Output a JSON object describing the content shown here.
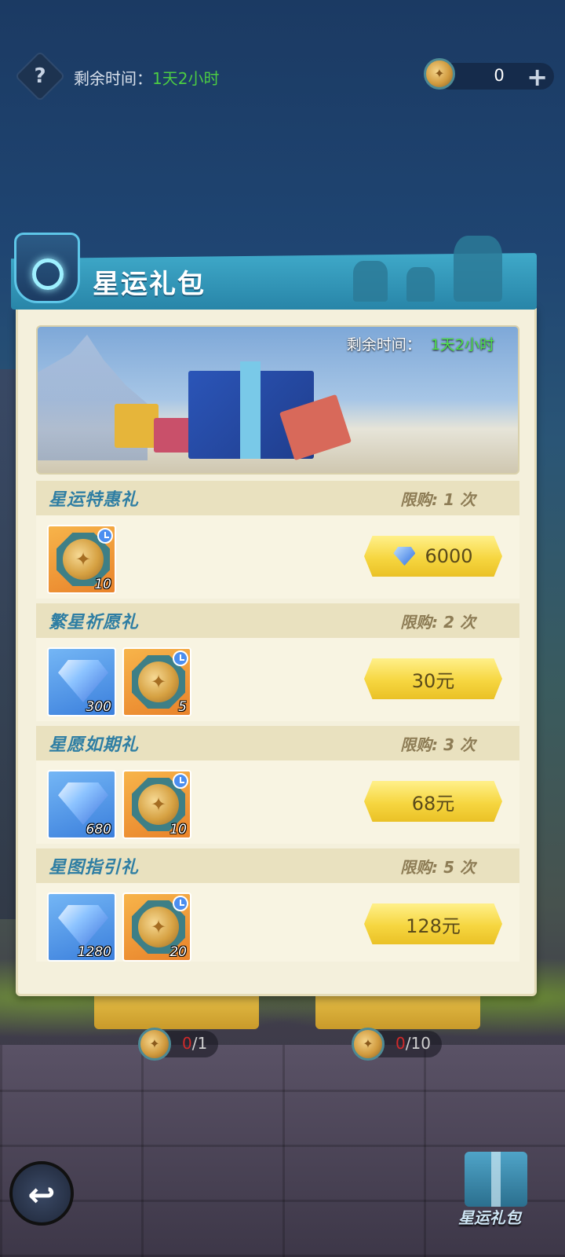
{
  "top_bar": {
    "help_label": "?",
    "time_label": "剩余时间：",
    "time_value": "1天2小时",
    "currency_value": "0",
    "add_label": "+"
  },
  "panel": {
    "title": "星运礼包",
    "banner": {
      "time_label": "剩余时间：",
      "time_value": "1天2小时"
    },
    "packs": [
      {
        "name": "星运特惠礼",
        "limit": "限购: 1 次",
        "items": [
          {
            "type": "star-token",
            "qty": "10"
          }
        ],
        "price": "6000",
        "price_currency_icon": "diamond-icon"
      },
      {
        "name": "繁星祈愿礼",
        "limit": "限购: 2 次",
        "items": [
          {
            "type": "diamond",
            "qty": "300"
          },
          {
            "type": "star-token",
            "qty": "5"
          }
        ],
        "price": "30元"
      },
      {
        "name": "星愿如期礼",
        "limit": "限购: 3 次",
        "items": [
          {
            "type": "diamond",
            "qty": "680"
          },
          {
            "type": "star-token",
            "qty": "10"
          }
        ],
        "price": "68元"
      },
      {
        "name": "星图指引礼",
        "limit": "限购: 5 次",
        "items": [
          {
            "type": "diamond",
            "qty": "1280"
          },
          {
            "type": "star-token",
            "qty": "20"
          }
        ],
        "price": "128元"
      }
    ]
  },
  "bottom": {
    "progress_left_cur": "0",
    "progress_left_max": "/1",
    "progress_right_cur": "0",
    "progress_right_max": "/10",
    "back_icon": "↩",
    "gift_entry_label": "星运礼包"
  },
  "colors": {
    "accent_blue": "#2f7ea3",
    "time_green": "#4ccc43",
    "buy_yellow": "#f6d640"
  }
}
